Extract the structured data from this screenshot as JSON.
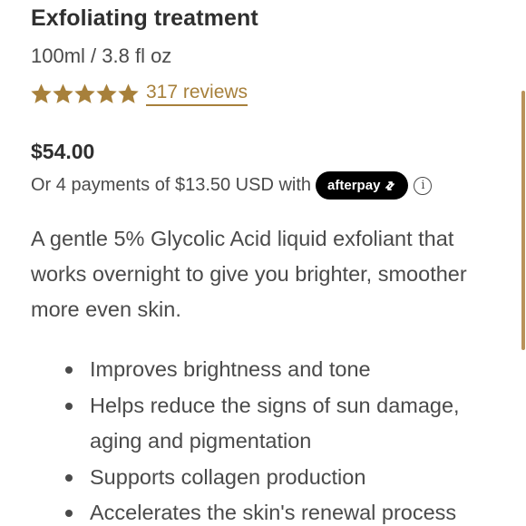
{
  "product": {
    "title": "Exfoliating treatment",
    "size": "100ml / 3.8 fl oz",
    "rating": 5,
    "rating_max": 5,
    "reviews_label": "317 reviews",
    "price": "$54.00",
    "installments_text": "Or 4 payments of $13.50 USD with",
    "afterpay_label": "afterpay",
    "info_icon": "info-icon",
    "description_lines": [
      "A gentle 5% Glycolic Acid liquid exfoliant that",
      "works overnight to give you brighter, smoother",
      "more even skin."
    ],
    "benefits": [
      {
        "lines": [
          "Improves brightness and tone"
        ]
      },
      {
        "lines": [
          "Helps reduce the signs of sun damage,",
          "aging and pigmentation"
        ]
      },
      {
        "lines": [
          "Supports collagen production"
        ]
      },
      {
        "lines": [
          "Accelerates the skin's renewal process"
        ]
      }
    ]
  },
  "colors": {
    "star": "#a7803b",
    "link": "#a7803b",
    "badge_bg": "#000000",
    "text": "#4a4a4a",
    "scrollbar": "#b8925a"
  }
}
